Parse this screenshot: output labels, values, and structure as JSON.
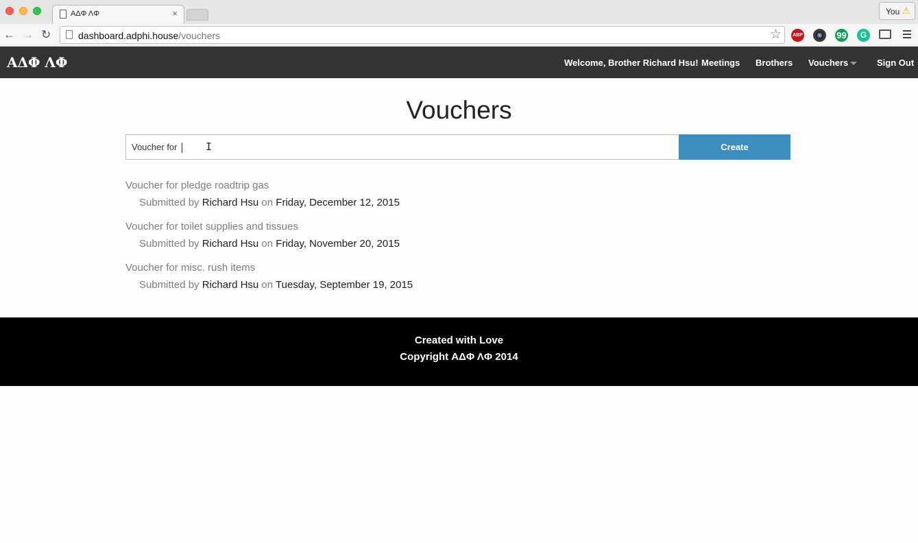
{
  "browser": {
    "tab_title": "ΑΔΦ ΛΦ",
    "tab_close": "×",
    "profile_label": "You",
    "profile_warning": "⚠",
    "url_host": "dashboard.adphi.house",
    "url_path": "/vouchers",
    "extensions": {
      "abp": "ABP",
      "hangouts": "99",
      "grammarly": "G"
    },
    "nav_icons": {
      "back": "←",
      "forward": "→",
      "reload": "↻",
      "star": "☆"
    }
  },
  "site": {
    "brand": "ΑΔΦ ΛΦ",
    "nav": {
      "welcome": "Welcome, Brother Richard Hsu!",
      "meetings": "Meetings",
      "brothers": "Brothers",
      "vouchers": "Vouchers",
      "sign_out": "Sign Out"
    }
  },
  "main": {
    "title": "Vouchers",
    "input_value": "Voucher for ",
    "create_label": "Create",
    "vouchers": [
      {
        "title": "Voucher for pledge roadtrip gas",
        "submitted_by_label": "Submitted by",
        "submitter": "Richard Hsu",
        "on_label": "on",
        "date": "Friday, December 12, 2015"
      },
      {
        "title": "Voucher for toilet supplies and tissues",
        "submitted_by_label": "Submitted by",
        "submitter": "Richard Hsu",
        "on_label": "on",
        "date": "Friday, November 20, 2015"
      },
      {
        "title": "Voucher for misc. rush items",
        "submitted_by_label": "Submitted by",
        "submitter": "Richard Hsu",
        "on_label": "on",
        "date": "Tuesday, September 19, 2015"
      }
    ]
  },
  "footer": {
    "line1": "Created with Love",
    "line2": "Copyright ΑΔΦ ΛΦ 2014"
  },
  "colors": {
    "navbar_bg": "#333333",
    "accent": "#3c8ebf",
    "footer_bg": "#000000",
    "muted_text": "#7d7d7d"
  }
}
